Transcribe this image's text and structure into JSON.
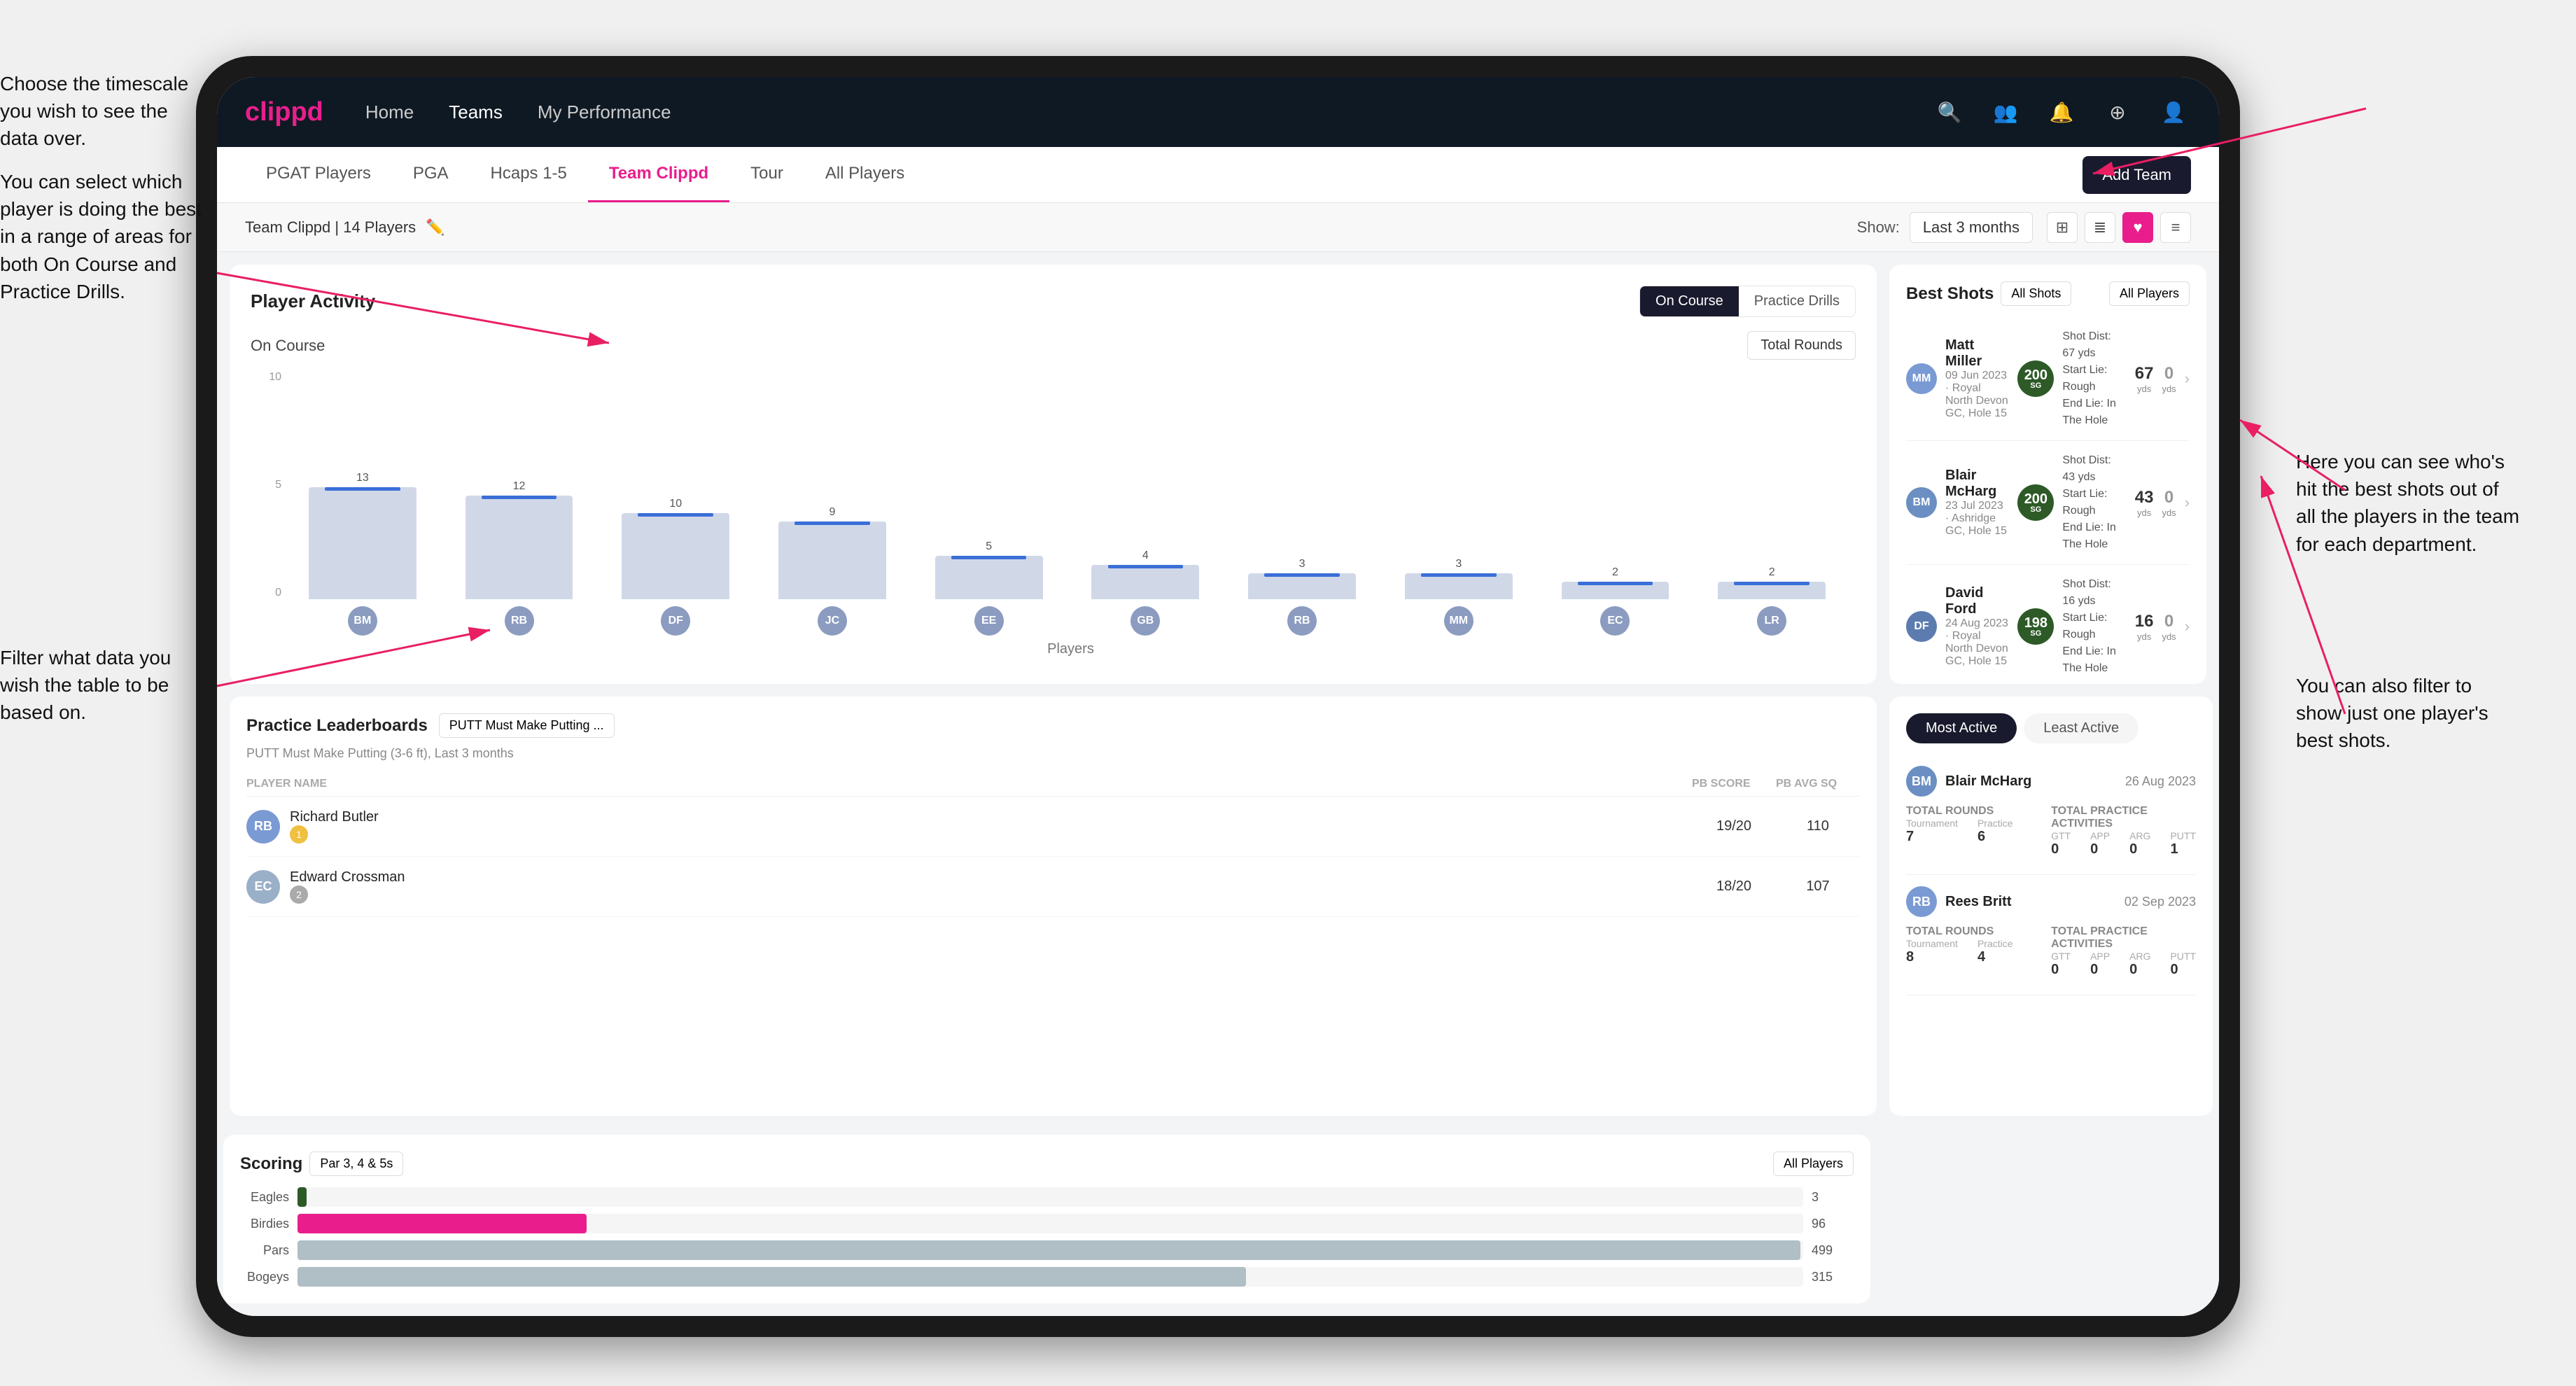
{
  "annotations": {
    "top_right": {
      "text": "Choose the timescale you wish to see the data over."
    },
    "left_top": {
      "text": "You can select which player is doing the best in a range of areas for both On Course and Practice Drills."
    },
    "left_bottom": {
      "text": "Filter what data you wish the table to be based on."
    },
    "right_bottom": {
      "text": "Here you can see who's hit the best shots out of all the players in the team for each department."
    },
    "far_right_bottom": {
      "text": "You can also filter to show just one player's best shots."
    }
  },
  "navbar": {
    "logo": "clippd",
    "links": [
      "Home",
      "Teams",
      "My Performance"
    ],
    "active_link": "Teams"
  },
  "tabs": {
    "items": [
      "PGAT Players",
      "PGA",
      "Hcaps 1-5",
      "Team Clippd",
      "Tour",
      "All Players"
    ],
    "active": "Team Clippd",
    "add_button": "Add Team"
  },
  "toolbar": {
    "team_label": "Team Clippd | 14 Players",
    "show_label": "Show:",
    "time_period": "Last 3 months"
  },
  "player_activity": {
    "title": "Player Activity",
    "toggle_on_course": "On Course",
    "toggle_practice": "Practice Drills",
    "active_toggle": "On Course",
    "sub_title": "On Course",
    "metric": "Total Rounds",
    "x_axis_label": "Players",
    "bars": [
      {
        "name": "B. McHarg",
        "value": 13,
        "height": 85,
        "initials": "BM",
        "color": "#8b9cc0"
      },
      {
        "name": "R. Britt",
        "value": 12,
        "height": 78,
        "initials": "RB",
        "color": "#8b9cc0"
      },
      {
        "name": "D. Ford",
        "value": 10,
        "height": 65,
        "initials": "DF",
        "color": "#8b9cc0"
      },
      {
        "name": "J. Coles",
        "value": 9,
        "height": 58,
        "initials": "JC",
        "color": "#8b9cc0"
      },
      {
        "name": "E. Ebert",
        "value": 5,
        "height": 32,
        "initials": "EE",
        "color": "#8b9cc0"
      },
      {
        "name": "G. Billingham",
        "value": 4,
        "height": 26,
        "initials": "GB",
        "color": "#8b9cc0"
      },
      {
        "name": "R. Butler",
        "value": 3,
        "height": 20,
        "initials": "RBu",
        "color": "#8b9cc0"
      },
      {
        "name": "M. Miller",
        "value": 3,
        "height": 20,
        "initials": "MM",
        "color": "#8b9cc0"
      },
      {
        "name": "E. Crossman",
        "value": 2,
        "height": 13,
        "initials": "EC",
        "color": "#8b9cc0"
      },
      {
        "name": "L. Robertson",
        "value": 2,
        "height": 13,
        "initials": "LR",
        "color": "#8b9cc0"
      }
    ],
    "y_labels": [
      "0",
      "5",
      "10"
    ]
  },
  "best_shots": {
    "title": "Best Shots",
    "filter_shots": "All Shots",
    "filter_players": "All Players",
    "players": [
      {
        "name": "Matt Miller",
        "meta": "09 Jun 2023 · Royal North Devon GC, Hole 15",
        "badge_num": "200",
        "badge_label": "SG",
        "badge_color": "#2d5a27",
        "shot_detail_1": "Shot Dist: 67 yds",
        "shot_detail_2": "Start Lie: Rough",
        "shot_detail_3": "End Lie: In The Hole",
        "stat1_value": "67",
        "stat1_label": "yds",
        "stat2_value": "0",
        "stat2_label": "yds",
        "initials": "MM",
        "avatar_color": "#7a9ad4"
      },
      {
        "name": "Blair McHarg",
        "meta": "23 Jul 2023 · Ashridge GC, Hole 15",
        "badge_num": "200",
        "badge_label": "SG",
        "badge_color": "#2d5a27",
        "shot_detail_1": "Shot Dist: 43 yds",
        "shot_detail_2": "Start Lie: Rough",
        "shot_detail_3": "End Lie: In The Hole",
        "stat1_value": "43",
        "stat1_label": "yds",
        "stat2_value": "0",
        "stat2_label": "yds",
        "initials": "BM",
        "avatar_color": "#6b8fc2"
      },
      {
        "name": "David Ford",
        "meta": "24 Aug 2023 · Royal North Devon GC, Hole 15",
        "badge_num": "198",
        "badge_label": "SG",
        "badge_color": "#2d5a27",
        "shot_detail_1": "Shot Dist: 16 yds",
        "shot_detail_2": "Start Lie: Rough",
        "shot_detail_3": "End Lie: In The Hole",
        "stat1_value": "16",
        "stat1_label": "yds",
        "stat2_value": "0",
        "stat2_label": "yds",
        "initials": "DF",
        "avatar_color": "#5c7cb0"
      }
    ]
  },
  "practice_leaderboards": {
    "title": "Practice Leaderboards",
    "dropdown": "PUTT Must Make Putting ...",
    "subtitle": "PUTT Must Make Putting (3-6 ft), Last 3 months",
    "columns": [
      "PLAYER NAME",
      "PB SCORE",
      "PB AVG SQ"
    ],
    "players": [
      {
        "name": "Richard Butler",
        "rank": "1",
        "rank_color": "#f0c040",
        "pb_score": "19/20",
        "pb_avg": "110",
        "initials": "RB",
        "avatar_color": "#7a9ad4"
      },
      {
        "name": "Edward Crossman",
        "rank": "2",
        "rank_color": "#aaa",
        "pb_score": "18/20",
        "pb_avg": "107",
        "initials": "EC",
        "avatar_color": "#9ab0c8"
      }
    ]
  },
  "most_active": {
    "tab_most_active": "Most Active",
    "tab_least_active": "Least Active",
    "active_tab": "Most Active",
    "players": [
      {
        "name": "Blair McHarg",
        "date": "26 Aug 2023",
        "total_rounds_label": "Total Rounds",
        "tournament_label": "Tournament",
        "tournament_value": "7",
        "practice_label": "Practice",
        "practice_value": "6",
        "total_practice_label": "Total Practice Activities",
        "gtt_label": "GTT",
        "gtt_value": "0",
        "app_label": "APP",
        "app_value": "0",
        "arg_label": "ARG",
        "arg_value": "0",
        "putt_label": "PUTT",
        "putt_value": "1",
        "initials": "BM",
        "avatar_color": "#6b8fc2"
      },
      {
        "name": "Rees Britt",
        "date": "02 Sep 2023",
        "total_rounds_label": "Total Rounds",
        "tournament_label": "Tournament",
        "tournament_value": "8",
        "practice_label": "Practice",
        "practice_value": "4",
        "total_practice_label": "Total Practice Activities",
        "gtt_label": "GTT",
        "gtt_value": "0",
        "app_label": "APP",
        "app_value": "0",
        "arg_label": "ARG",
        "arg_value": "0",
        "putt_label": "PUTT",
        "putt_value": "0",
        "initials": "RB",
        "avatar_color": "#7a9ad4"
      }
    ]
  },
  "scoring": {
    "title": "Scoring",
    "filter_par": "Par 3, 4 & 5s",
    "filter_players": "All Players",
    "bars": [
      {
        "label": "Eagles",
        "value": 3,
        "max": 500,
        "color": "#2d5a27",
        "display": "3"
      },
      {
        "label": "Birdies",
        "value": 96,
        "max": 500,
        "color": "#e91e8c",
        "display": "96"
      },
      {
        "label": "Pars",
        "value": 499,
        "max": 500,
        "color": "#b0bec5",
        "display": "499"
      },
      {
        "label": "Bogeys",
        "value": 315,
        "max": 500,
        "color": "#b0bec5",
        "display": "315"
      }
    ]
  }
}
